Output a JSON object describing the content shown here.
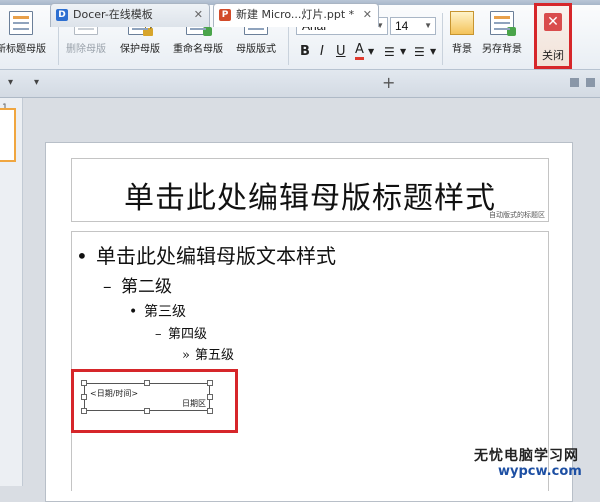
{
  "ribbon": {
    "buttons": [
      {
        "id": "new-title-master",
        "label": "新标题母版",
        "enabled": true
      },
      {
        "id": "delete-master",
        "label": "删除母版",
        "enabled": false
      },
      {
        "id": "protect-master",
        "label": "保护母版",
        "enabled": true
      },
      {
        "id": "rename-master",
        "label": "重命名母版",
        "enabled": true
      },
      {
        "id": "master-layout",
        "label": "母版版式",
        "enabled": true
      },
      {
        "id": "background",
        "label": "背景",
        "enabled": true
      },
      {
        "id": "save-background",
        "label": "另存背景",
        "enabled": true
      }
    ],
    "font_name": "Arial",
    "font_size": "14",
    "format_buttons": [
      "B",
      "I",
      "U",
      "A"
    ],
    "close_label": "关闭"
  },
  "tabs": [
    {
      "label": "Docer-在线模板",
      "icon": "D",
      "active": false
    },
    {
      "label": "新建 Micro...灯片.ppt *",
      "icon": "P",
      "active": true
    }
  ],
  "thumbnail_number": "1",
  "slide": {
    "title": "单击此处编辑母版标题样式",
    "title_area_label": "自动版式的标题区",
    "levels": [
      {
        "bullet": "•",
        "text": "单击此处编辑母版文本样式"
      },
      {
        "bullet": "–",
        "text": "第二级"
      },
      {
        "bullet": "•",
        "text": "第三级"
      },
      {
        "bullet": "–",
        "text": "第四级"
      },
      {
        "bullet": "»",
        "text": "第五级"
      }
    ],
    "date_placeholder": "<日期/时间>",
    "date_area_label": "日期区"
  },
  "watermark": {
    "line1": "无忧电脑学习网",
    "line2": "wypcw.com"
  },
  "colors": {
    "highlight": "#d6262a",
    "ribbon_bg": "#eef2f6",
    "active_tab": "#ffffff"
  }
}
